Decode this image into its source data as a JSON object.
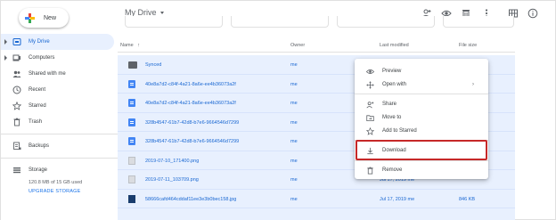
{
  "sidebar": {
    "new_label": "New",
    "items": [
      {
        "label": "My Drive",
        "icon": "drive-icon",
        "active": true
      },
      {
        "label": "Computers",
        "icon": "computer-icon"
      },
      {
        "label": "Shared with me",
        "icon": "people-icon"
      },
      {
        "label": "Recent",
        "icon": "clock-icon"
      },
      {
        "label": "Starred",
        "icon": "star-icon"
      },
      {
        "label": "Trash",
        "icon": "trash-icon"
      },
      {
        "label": "Backups",
        "icon": "backup-icon"
      },
      {
        "label": "Storage",
        "icon": "storage-icon"
      }
    ],
    "storage_used": "120.8 MB of 15 GB used",
    "upgrade_label": "UPGRADE STORAGE"
  },
  "header": {
    "title": "My Drive",
    "icons": [
      "add-person-icon",
      "eye-icon",
      "trash-icon",
      "more-vert-icon",
      "grid-view-icon",
      "info-icon"
    ]
  },
  "list": {
    "columns": {
      "name": "Name",
      "sort_arrow": "↑",
      "owner": "Owner",
      "modified": "Last modified",
      "size": "File size"
    },
    "rows": [
      {
        "name": "Synced",
        "owner": "me",
        "modified": "",
        "size": "",
        "type": "folder"
      },
      {
        "name": "40e8a7d2-c84f-4a21-8a6e-ee4b36073a2f",
        "owner": "me",
        "modified": "",
        "size": "",
        "type": "doc"
      },
      {
        "name": "40e8a7d2-c84f-4a21-8a6e-ee4b36073a2f",
        "owner": "me",
        "modified": "",
        "size": "",
        "type": "doc"
      },
      {
        "name": "328b4547-61b7-42d8-b7e6-9664546d7299",
        "owner": "me",
        "modified": "",
        "size": "",
        "type": "doc"
      },
      {
        "name": "328b4547-61b7-42d8-b7e6-9664546d7299",
        "owner": "me",
        "modified": "",
        "size": "",
        "type": "doc"
      },
      {
        "name": "2019-07-10_171400.png",
        "owner": "me",
        "modified": "",
        "size": "",
        "type": "image"
      },
      {
        "name": "2019-07-11_103709.png",
        "owner": "me",
        "modified": "Jul 17, 2019 me",
        "size": "",
        "type": "image"
      },
      {
        "name": "58666cafd464cddaf11ee3e3b0bec158.jpg",
        "owner": "me",
        "modified": "Jul 17, 2019 me",
        "size": "846 KB",
        "type": "photo"
      }
    ]
  },
  "context_menu": {
    "items": [
      {
        "label": "Preview",
        "icon": "eye-icon"
      },
      {
        "label": "Open with",
        "icon": "move-icon",
        "submenu": "›"
      },
      {
        "label": "Share",
        "icon": "add-person-icon"
      },
      {
        "label": "Move to",
        "icon": "move-to-folder-icon"
      },
      {
        "label": "Add to Starred",
        "icon": "star-icon"
      },
      {
        "label": "Download",
        "icon": "download-icon"
      },
      {
        "label": "Remove",
        "icon": "trash-icon"
      }
    ]
  },
  "colors": {
    "accent": "#1967d2",
    "selection": "#e8f0fe",
    "highlight_border": "#c62828"
  }
}
